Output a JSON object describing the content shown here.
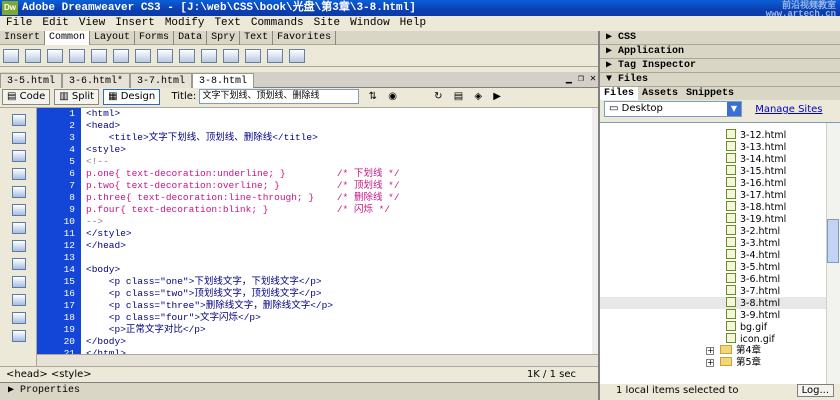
{
  "window": {
    "title": "Adobe Dreamweaver CS3 - [J:\\web\\CSS\\book\\光盘\\第3章\\3-8.html]",
    "logo": "Dw",
    "watermark": "前沿视频教室\nwww.artech.cn"
  },
  "menu": [
    "File",
    "Edit",
    "View",
    "Insert",
    "Modify",
    "Text",
    "Commands",
    "Site",
    "Window",
    "Help"
  ],
  "insert_tabs": [
    "Insert",
    "Common",
    "Layout",
    "Forms",
    "Data",
    "Spry",
    "Text",
    "Favorites"
  ],
  "doc_tabs": [
    "3-5.html",
    "3-6.html*",
    "3-7.html",
    "3-8.html"
  ],
  "toolbar": {
    "code": "Code",
    "split": "Split",
    "design": "Design",
    "title_label": "Title:",
    "title_value": "文字下划线、顶划线、删除线"
  },
  "code_lines": [
    {
      "n": "1",
      "t": "<html>"
    },
    {
      "n": "2",
      "t": "<head>"
    },
    {
      "n": "3",
      "t": "    <title>文字下划线、顶划线、删除线</title>"
    },
    {
      "n": "4",
      "t": "<style>"
    },
    {
      "n": "5",
      "t": "<!--"
    },
    {
      "n": "6",
      "t": "p.one{ text-decoration:underline; }         /* 下划线 */"
    },
    {
      "n": "7",
      "t": "p.two{ text-decoration:overline; }          /* 顶划线 */"
    },
    {
      "n": "8",
      "t": "p.three{ text-decoration:line-through; }    /* 删除线 */"
    },
    {
      "n": "9",
      "t": "p.four{ text-decoration:blink; }            /* 闪烁 */"
    },
    {
      "n": "10",
      "t": "-->"
    },
    {
      "n": "11",
      "t": "</style>"
    },
    {
      "n": "12",
      "t": "</head>"
    },
    {
      "n": "13",
      "t": ""
    },
    {
      "n": "14",
      "t": "<body>"
    },
    {
      "n": "15",
      "t": "    <p class=\"one\">下划线文字，下划线文字</p>"
    },
    {
      "n": "16",
      "t": "    <p class=\"two\">顶划线文字，顶划线文字</p>"
    },
    {
      "n": "17",
      "t": "    <p class=\"three\">删除线文字，删除线文字</p>"
    },
    {
      "n": "18",
      "t": "    <p class=\"four\">文字闪烁</p>"
    },
    {
      "n": "19",
      "t": "    <p>正常文字对比</p>"
    },
    {
      "n": "20",
      "t": "</body>"
    },
    {
      "n": "21",
      "t": "</html>"
    }
  ],
  "status": {
    "tags": "<head> <style>",
    "info": "1K / 1 sec"
  },
  "properties_label": "Properties",
  "panels": {
    "css": "CSS",
    "application": "Application",
    "tag_inspector": "Tag Inspector",
    "files": "Files"
  },
  "files_tabs": [
    "Files",
    "Assets",
    "Snippets"
  ],
  "site_select": "Desktop",
  "manage_sites": "Manage Sites",
  "file_items": [
    {
      "name": "3-12.html",
      "type": "file"
    },
    {
      "name": "3-13.html",
      "type": "file"
    },
    {
      "name": "3-14.html",
      "type": "file"
    },
    {
      "name": "3-15.html",
      "type": "file"
    },
    {
      "name": "3-16.html",
      "type": "file"
    },
    {
      "name": "3-17.html",
      "type": "file"
    },
    {
      "name": "3-18.html",
      "type": "file"
    },
    {
      "name": "3-19.html",
      "type": "file"
    },
    {
      "name": "3-2.html",
      "type": "file"
    },
    {
      "name": "3-3.html",
      "type": "file"
    },
    {
      "name": "3-4.html",
      "type": "file"
    },
    {
      "name": "3-5.html",
      "type": "file"
    },
    {
      "name": "3-6.html",
      "type": "file"
    },
    {
      "name": "3-7.html",
      "type": "file"
    },
    {
      "name": "3-8.html",
      "type": "file",
      "selected": true
    },
    {
      "name": "3-9.html",
      "type": "file"
    },
    {
      "name": "bg.gif",
      "type": "image"
    },
    {
      "name": "icon.gif",
      "type": "image"
    },
    {
      "name": "第4章",
      "type": "folder"
    },
    {
      "name": "第5章",
      "type": "folder"
    }
  ],
  "files_status": "1 local items selected to",
  "log_button": "Log..."
}
